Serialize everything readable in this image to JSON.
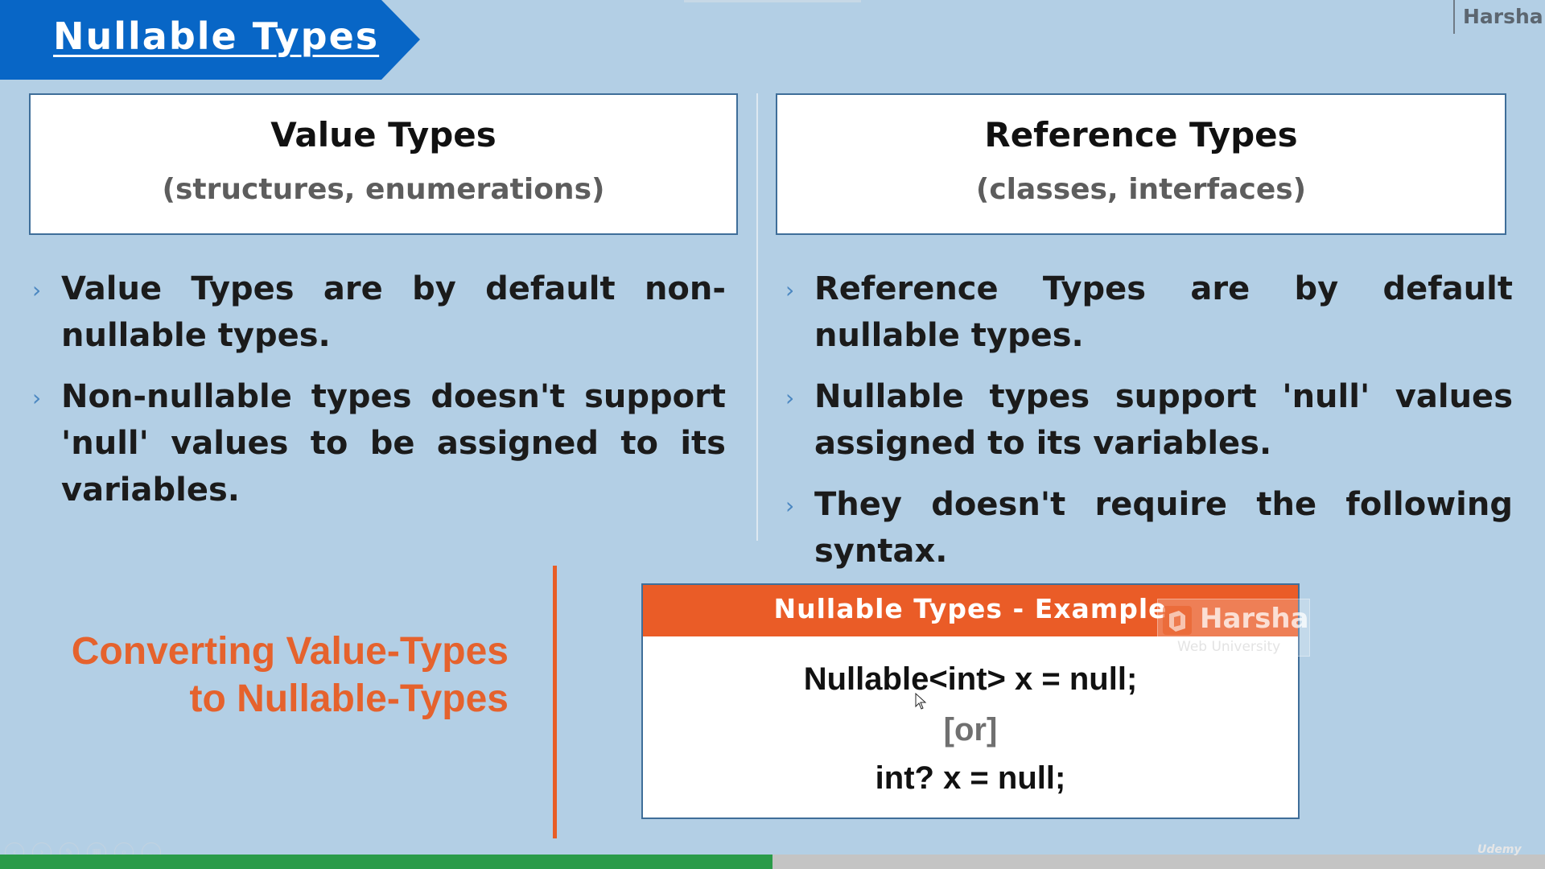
{
  "slide": {
    "title": "Nullable Types",
    "author": "Harsha"
  },
  "left_column": {
    "heading": "Value Types",
    "subheading": "(structures, enumerations)",
    "bullets": [
      "Value Types are by default non-nullable types.",
      "Non-nullable types doesn't support 'null' values to be assigned to its variables."
    ]
  },
  "right_column": {
    "heading": "Reference Types",
    "subheading": "(classes, interfaces)",
    "bullets": [
      "Reference Types are by default nullable types.",
      "Nullable types support 'null' values assigned to its variables.",
      "They doesn't require the following syntax."
    ]
  },
  "conversion": {
    "line1": "Converting Value-Types",
    "line2": "to Nullable-Types"
  },
  "example": {
    "header": "Nullable Types - Example",
    "code_line1": "Nullable<int> x = null;",
    "separator": "[or]",
    "code_line2": "int? x = null;"
  },
  "watermark": {
    "name": "Harsha",
    "subtitle": "Web University"
  },
  "player": {
    "progress_fraction": 0.5,
    "brand": "Udemy"
  },
  "colors": {
    "background": "#b3cfe5",
    "title_banner": "#0866c6",
    "accent_orange": "#ea5c27",
    "progress": "#2a9b49",
    "bullet_arrow": "#4b87c1"
  },
  "icons": [
    "chevron-right-icon",
    "mouse-cursor-icon",
    "watermark-logo-icon"
  ]
}
